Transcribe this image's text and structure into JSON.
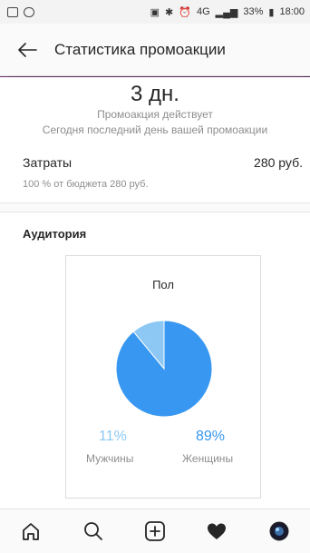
{
  "status_bar": {
    "battery": "33%",
    "time": "18:00",
    "network": "4G"
  },
  "header": {
    "title": "Статистика промоакции"
  },
  "promo": {
    "days_left": "3 дн.",
    "status_text": "Промоакция действует",
    "last_day_text": "Сегодня последний день вашей промоакции"
  },
  "spend": {
    "label": "Затраты",
    "value": "280 руб.",
    "budget_text": "100 % от бюджета 280 руб."
  },
  "audience": {
    "title": "Аудитория",
    "card_title": "Пол",
    "men_pct": "11%",
    "men_label": "Мужчины",
    "women_pct": "89%",
    "women_label": "Женщины"
  },
  "chart_data": {
    "type": "pie",
    "title": "Пол",
    "categories": [
      "Мужчины",
      "Женщины"
    ],
    "values": [
      11,
      89
    ],
    "colors": [
      "#8cc8f3",
      "#3897f0"
    ]
  },
  "colors": {
    "accent_blue": "#3897f0",
    "light_blue": "#8cc8f3"
  },
  "nav": {
    "icons": [
      "home-icon",
      "search-icon",
      "add-post-icon",
      "activity-heart-icon",
      "profile-avatar"
    ]
  }
}
